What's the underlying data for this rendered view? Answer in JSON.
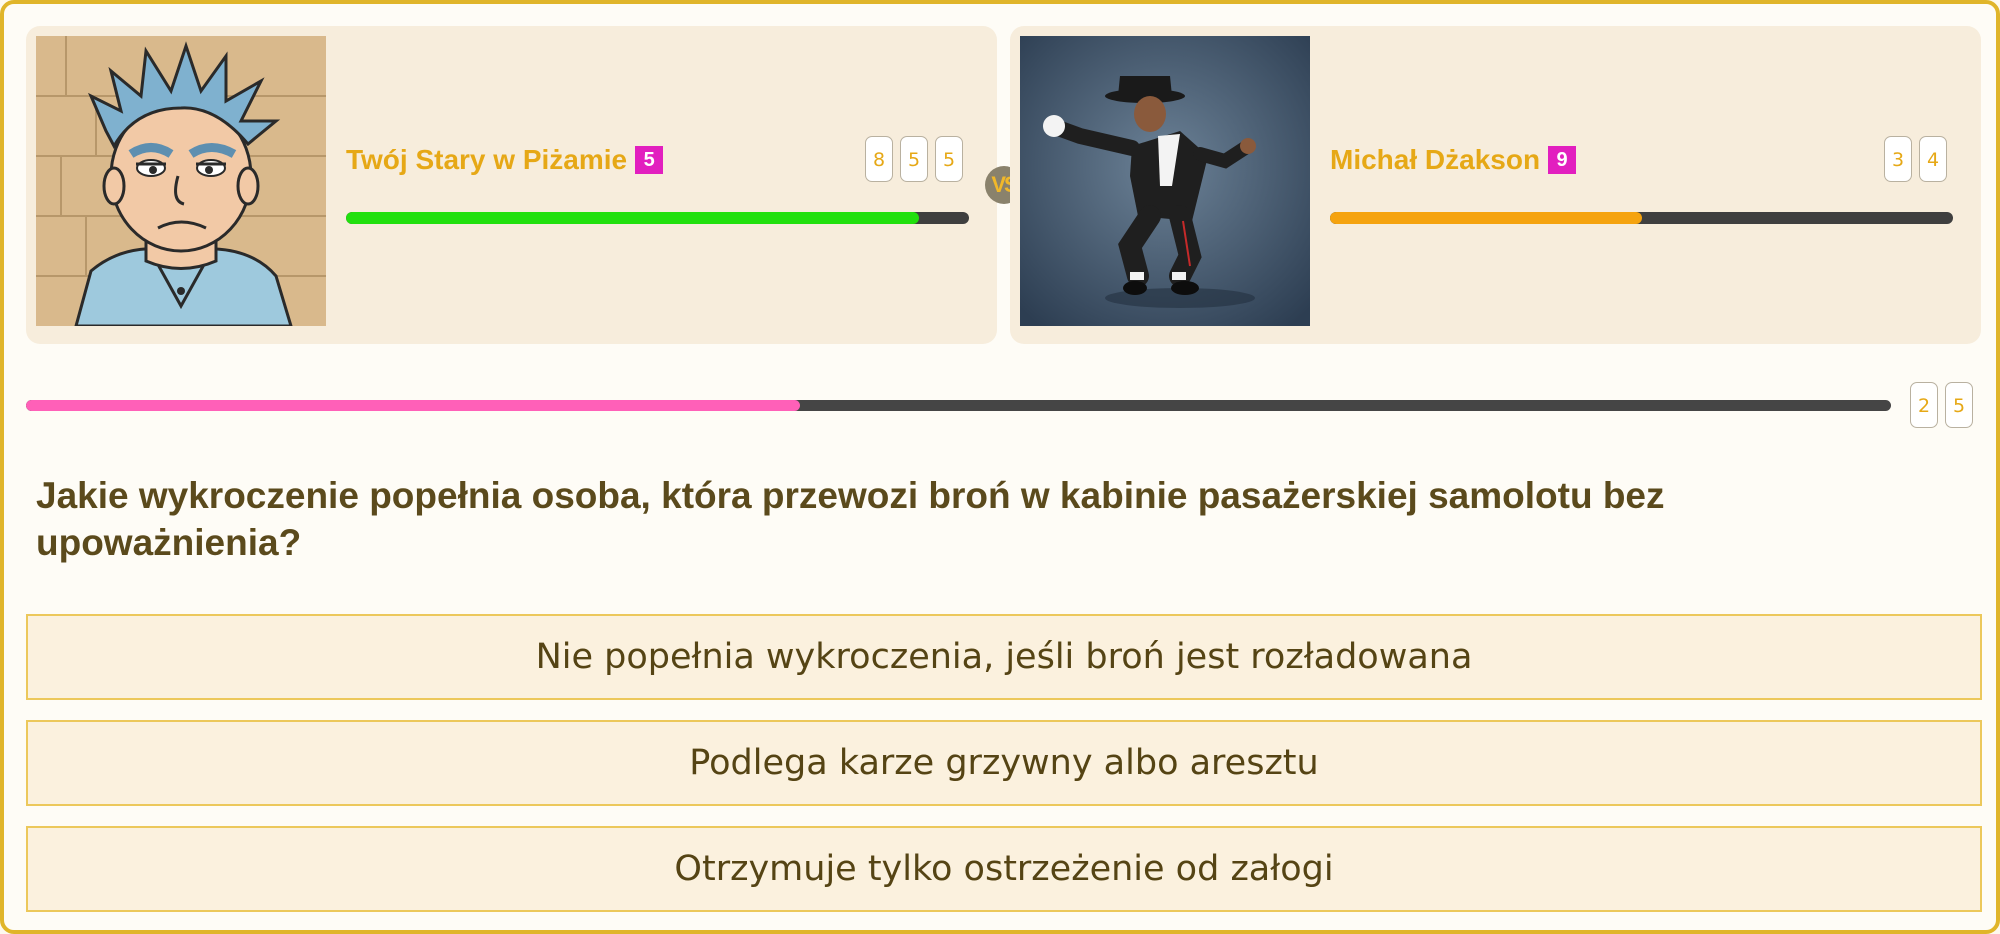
{
  "player1": {
    "name": "Twój Stary w Piżamie",
    "level": "5",
    "score_digits": [
      "8",
      "5",
      "5"
    ],
    "health": 0.92,
    "health_color": "#22e00e"
  },
  "vs_label": "VS",
  "player2": {
    "name": "Michał Dżakson",
    "level": "9",
    "score_digits": [
      "3",
      "4"
    ],
    "health": 0.5,
    "health_color": "#f5a30f"
  },
  "timer": {
    "progress": 0.415,
    "digits": [
      "2",
      "5"
    ],
    "fill_color": "#ff60b8"
  },
  "question": "Jakie wykroczenie popełnia osoba, która przewozi broń w kabinie pasażerskiej samolotu bez upoważnienia?",
  "answers": [
    "Nie popełnia wykroczenia, jeśli broń jest rozładowana",
    "Podlega karze grzywny albo aresztu",
    "Otrzymuje tylko ostrzeżenie od załogi"
  ]
}
